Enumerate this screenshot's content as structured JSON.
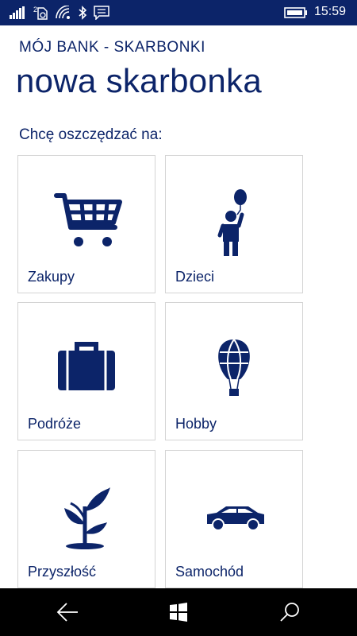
{
  "status_bar": {
    "time": "15:59",
    "icons": [
      "signal-icon",
      "sim-icon",
      "wifi-icon",
      "bluetooth-icon",
      "notification-icon",
      "battery-icon"
    ]
  },
  "header": {
    "app_title": "MÓJ BANK - SKARBONKI",
    "page_title": "nowa skarbonka"
  },
  "main": {
    "section_label": "Chcę oszczędzać na:",
    "categories": [
      {
        "label": "Zakupy",
        "icon": "shopping-cart-icon"
      },
      {
        "label": "Dzieci",
        "icon": "child-with-balloon-icon"
      },
      {
        "label": "Podróże",
        "icon": "suitcase-icon"
      },
      {
        "label": "Hobby",
        "icon": "hot-air-balloon-icon"
      },
      {
        "label": "Przyszłość",
        "icon": "plant-sprout-icon"
      },
      {
        "label": "Samochód",
        "icon": "car-icon"
      }
    ]
  },
  "nav_bar": {
    "buttons": [
      "back-arrow-icon",
      "windows-start-icon",
      "search-icon"
    ]
  },
  "colors": {
    "brand": "#0c2469",
    "tile_border": "#d4d4d4",
    "nav_bar": "#000000"
  }
}
